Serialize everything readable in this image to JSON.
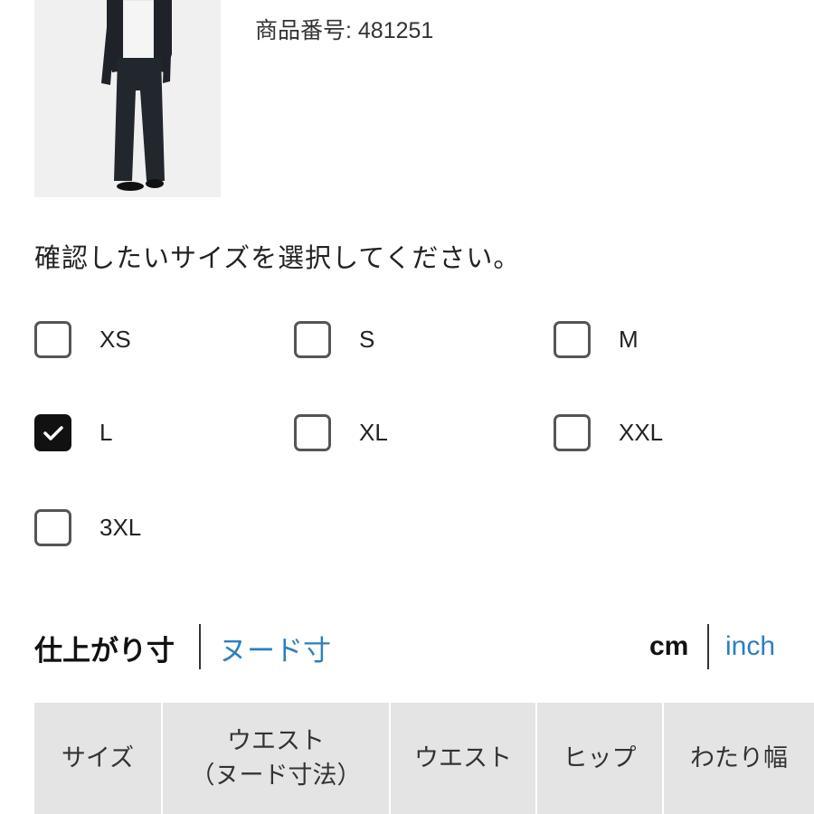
{
  "product": {
    "number_label": "商品番号:",
    "number": "481251"
  },
  "instruction": "確認したいサイズを選択してください。",
  "sizes": [
    {
      "label": "XS",
      "checked": false
    },
    {
      "label": "S",
      "checked": false
    },
    {
      "label": "M",
      "checked": false
    },
    {
      "label": "L",
      "checked": true
    },
    {
      "label": "XL",
      "checked": false
    },
    {
      "label": "XXL",
      "checked": false
    },
    {
      "label": "3XL",
      "checked": false
    }
  ],
  "measure_tabs": {
    "active": "仕上がり寸",
    "inactive": "ヌード寸"
  },
  "units": {
    "active": "cm",
    "inactive": "inch"
  },
  "table": {
    "headers": [
      "サイズ",
      "ウエスト",
      "（ヌード寸法）",
      "ウエスト",
      "ヒップ",
      "わたり幅"
    ]
  },
  "colors": {
    "link_blue": "#2d7fbf",
    "checked_fill": "#111111",
    "table_header_bg": "#e4e4e4"
  }
}
